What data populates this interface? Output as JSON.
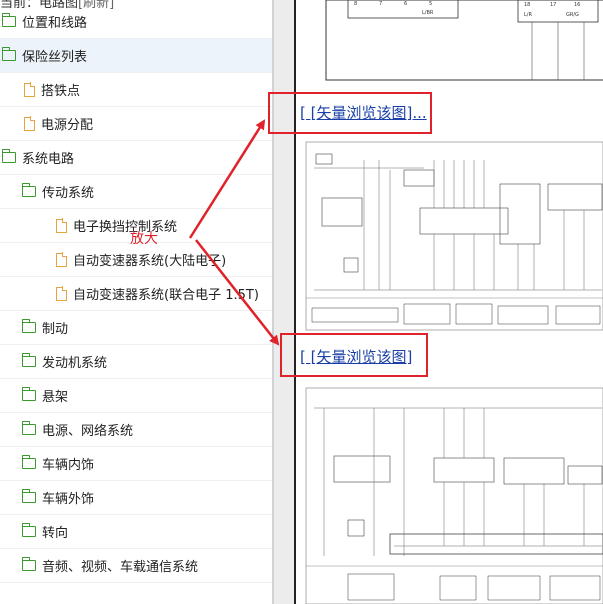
{
  "tree": {
    "top_partial": "当前：电路图",
    "top_partial2": "[刷新]",
    "items": [
      {
        "label": "位置和线路",
        "icon": "folder-icon"
      },
      {
        "label": "保险丝列表",
        "icon": "folder-icon"
      },
      {
        "label": "搭铁点",
        "icon": "file-icon"
      },
      {
        "label": "电源分配",
        "icon": "file-icon"
      },
      {
        "label": "系统电路",
        "icon": "folder-icon"
      },
      {
        "label": "传动系统",
        "icon": "folder-icon"
      },
      {
        "label": "电子换挡控制系统",
        "icon": "file-icon"
      },
      {
        "label": "自动变速器系统(大陆电子)",
        "icon": "file-icon"
      },
      {
        "label": "自动变速器系统(联合电子 1.5T)",
        "icon": "file-icon"
      },
      {
        "label": "制动",
        "icon": "folder-icon"
      },
      {
        "label": "发动机系统",
        "icon": "folder-icon"
      },
      {
        "label": "悬架",
        "icon": "folder-icon"
      },
      {
        "label": "电源、网络系统",
        "icon": "folder-icon"
      },
      {
        "label": "车辆内饰",
        "icon": "folder-icon"
      },
      {
        "label": "车辆外饰",
        "icon": "folder-icon"
      },
      {
        "label": "转向",
        "icon": "folder-icon"
      },
      {
        "label": "音频、视频、车载通信系统",
        "icon": "folder-icon"
      }
    ]
  },
  "content": {
    "link1": "[ [矢量浏览该图]...",
    "link2": "[ [矢量浏览该图]",
    "annotation": "放大",
    "top_diagram_labels": [
      "8",
      "7",
      "6",
      "5",
      "L/BR",
      "18",
      "17",
      "16",
      "L/R",
      "GR/G"
    ]
  },
  "colors": {
    "accent_red": "#e0232b",
    "link_blue": "#1a3fa6",
    "folder_green": "#3a9a2e",
    "file_orange": "#e7a33c"
  }
}
